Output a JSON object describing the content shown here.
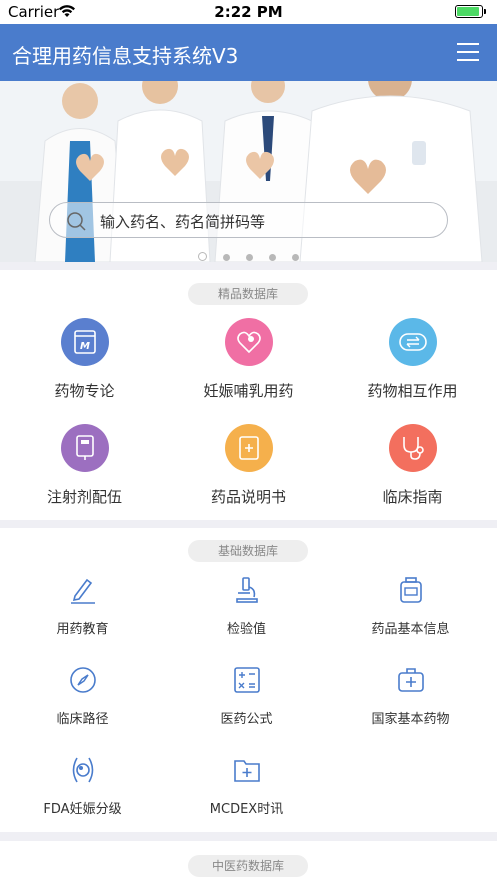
{
  "status_bar": {
    "carrier": "Carrier",
    "time": "2:22 PM",
    "battery_level": 0.95
  },
  "nav": {
    "title": "合理用药信息支持系统V3",
    "menu_icon": "menu-icon"
  },
  "banner": {
    "search_placeholder": "输入药名、药名简拼码等",
    "dots_count": 5,
    "active_dot": 0
  },
  "premium": {
    "label": "精品数据库",
    "items": [
      {
        "label": "药物专论",
        "icon": "monograph-icon",
        "color": "#5a7fcf"
      },
      {
        "label": "妊娠哺乳用药",
        "icon": "pregnancy-icon",
        "color": "#f06fa4"
      },
      {
        "label": "药物相互作用",
        "icon": "interaction-icon",
        "color": "#5bb8e8"
      },
      {
        "label": "注射剂配伍",
        "icon": "injection-icon",
        "color": "#9c6fc0"
      },
      {
        "label": "药品说明书",
        "icon": "manual-icon",
        "color": "#f5b04c"
      },
      {
        "label": "临床指南",
        "icon": "stethoscope-icon",
        "color": "#f36f5e"
      }
    ]
  },
  "basic": {
    "label": "基础数据库",
    "items": [
      {
        "label": "用药教育",
        "icon": "pen-icon"
      },
      {
        "label": "检验值",
        "icon": "microscope-icon"
      },
      {
        "label": "药品基本信息",
        "icon": "medicine-bottle-icon"
      },
      {
        "label": "临床路径",
        "icon": "compass-icon"
      },
      {
        "label": "医药公式",
        "icon": "formula-icon"
      },
      {
        "label": "国家基本药物",
        "icon": "medkit-icon"
      },
      {
        "label": "FDA妊娠分级",
        "icon": "fetus-icon"
      },
      {
        "label": "MCDEX时讯",
        "icon": "news-folder-icon"
      }
    ]
  },
  "tcm": {
    "label": "中医药数据库"
  }
}
